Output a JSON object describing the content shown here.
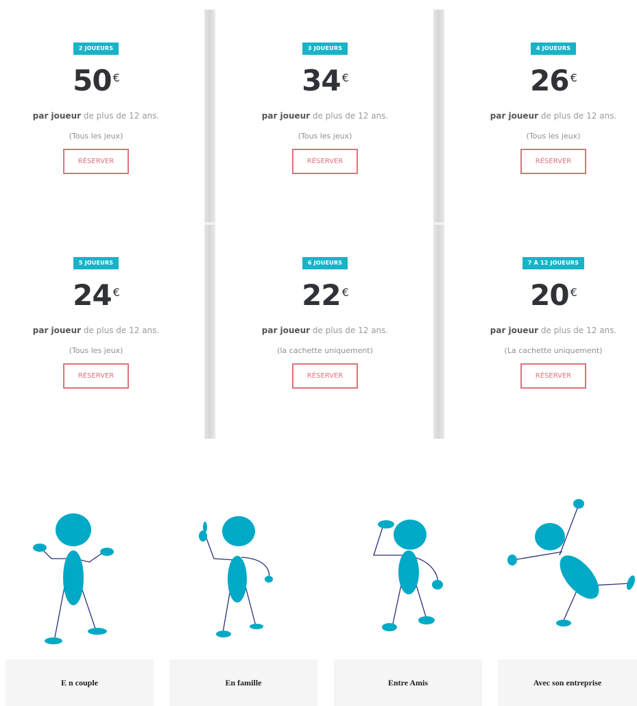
{
  "pricing": [
    {
      "badge": "2 JOUEURS",
      "price": "50",
      "currency": "€",
      "per_bold": "par joueur",
      "per_rest": " de plus de 12 ans.",
      "note": "(Tous les jeux)",
      "button": "RÉSERVER"
    },
    {
      "badge": "3 JOUEURS",
      "price": "34",
      "currency": "€",
      "per_bold": "par joueur",
      "per_rest": " de plus de 12 ans.",
      "note": "(Tous les jeux)",
      "button": "RÉSERVER"
    },
    {
      "badge": "4 JOUEURS",
      "price": "26",
      "currency": "€",
      "per_bold": "par joueur",
      "per_rest": " de plus de 12 ans.",
      "note": "(Tous les jeux)",
      "button": "RÉSERVER"
    },
    {
      "badge": "5 JOUEURS",
      "price": "24",
      "currency": "€",
      "per_bold": "par joueur",
      "per_rest": " de plus de 12 ans.",
      "note": "(Tous les jeux)",
      "button": "RÉSERVER"
    },
    {
      "badge": "6 JOUEURS",
      "price": "22",
      "currency": "€",
      "per_bold": "par joueur",
      "per_rest": " de plus de 12 ans.",
      "note": "(la cachette uniquement)",
      "button": "RÉSERVER"
    },
    {
      "badge": "7 À 12 JOUEURS",
      "price": "20",
      "currency": "€",
      "per_bold": "par joueur",
      "per_rest": " de plus de 12 ans.",
      "note": "(La cachette uniquement)",
      "button": "RÉSERVER"
    }
  ],
  "categories": [
    {
      "label": "E n couple",
      "icon": "stick-figure-shrug-icon"
    },
    {
      "label": "En famille",
      "icon": "stick-figure-pointing-icon"
    },
    {
      "label": "Entre Amis",
      "icon": "stick-figure-thinking-icon"
    },
    {
      "label": "Avec son entreprise",
      "icon": "stick-figure-jumping-icon"
    }
  ],
  "colors": {
    "badge": "#19b3c8",
    "button": "#e0717c",
    "figure": "#00a9c6",
    "limb": "#2b2f7a"
  }
}
